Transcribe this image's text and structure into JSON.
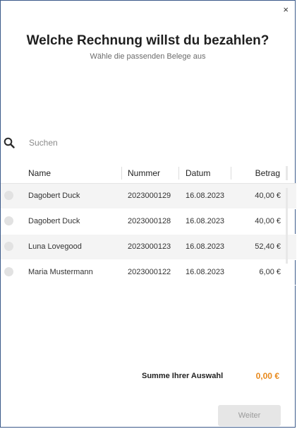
{
  "dialog": {
    "close_glyph": "×",
    "title": "Welche Rechnung willst du bezahlen?",
    "subtitle": "Wähle die passenden Belege aus"
  },
  "search": {
    "placeholder": "Suchen",
    "value": ""
  },
  "table": {
    "columns": [
      "Name",
      "Nummer",
      "Datum",
      "Betrag"
    ],
    "rows": [
      {
        "name": "Dagobert Duck",
        "nummer": "2023000129",
        "datum": "16.08.2023",
        "betrag": "40,00 €"
      },
      {
        "name": "Dagobert Duck",
        "nummer": "2023000128",
        "datum": "16.08.2023",
        "betrag": "40,00 €"
      },
      {
        "name": "Luna Lovegood",
        "nummer": "2023000123",
        "datum": "16.08.2023",
        "betrag": "52,40 €"
      },
      {
        "name": "Maria Mustermann",
        "nummer": "2023000122",
        "datum": "16.08.2023",
        "betrag": "6,00 €"
      }
    ]
  },
  "summary": {
    "label": "Summe Ihrer Auswahl",
    "value": "0,00 €",
    "value_color": "#e8891c"
  },
  "footer": {
    "next_label": "Weiter"
  },
  "icons": {
    "close": "close-icon",
    "search": "search-icon",
    "radio": "radio-unchecked-icon"
  }
}
